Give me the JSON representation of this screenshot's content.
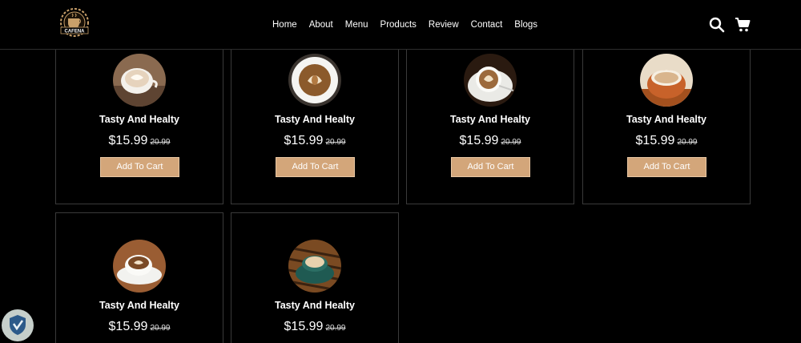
{
  "header": {
    "logo_text": "CAFENA",
    "nav": [
      "Home",
      "About",
      "Menu",
      "Products",
      "Review",
      "Contact",
      "Blogs"
    ],
    "search_icon": "search-icon",
    "cart_icon": "cart-icon"
  },
  "products": [
    {
      "name": "Tasty And Healty",
      "price": "$15.99",
      "old_price": "20.99",
      "button": "Add To Cart"
    },
    {
      "name": "Tasty And Healty",
      "price": "$15.99",
      "old_price": "20.99",
      "button": "Add To Cart"
    },
    {
      "name": "Tasty And Healty",
      "price": "$15.99",
      "old_price": "20.99",
      "button": "Add To Cart"
    },
    {
      "name": "Tasty And Healty",
      "price": "$15.99",
      "old_price": "20.99",
      "button": "Add To Cart"
    },
    {
      "name": "Tasty And Healty",
      "price": "$15.99",
      "old_price": "20.99",
      "button": "Add To Cart"
    },
    {
      "name": "Tasty And Healty",
      "price": "$15.99",
      "old_price": "20.99",
      "button": "Add To Cart"
    }
  ],
  "colors": {
    "accent": "#d3a67a",
    "background": "#000000",
    "border": "#3a3a3a"
  }
}
